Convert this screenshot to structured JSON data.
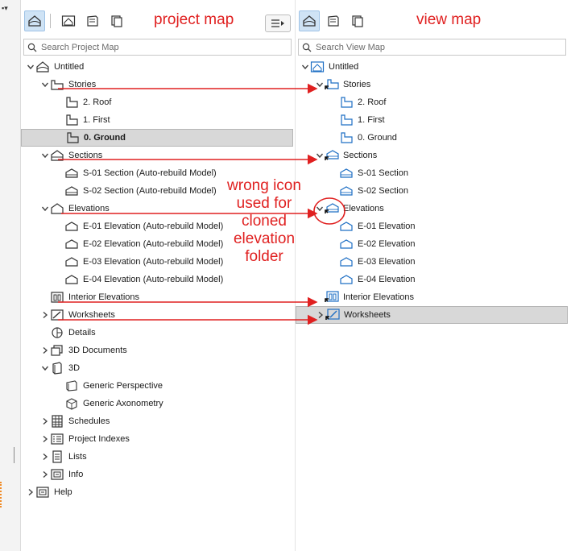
{
  "colors": {
    "accent": "#e02020",
    "selected_row": "#d8d8d8",
    "active_tab": "#cfe3f5",
    "icon_blue": "#1e6fc4"
  },
  "project_map": {
    "annotation_title": "project map",
    "search_placeholder": "Search Project Map",
    "rows": [
      {
        "label": "Untitled",
        "icon": "project-house-icon",
        "chevron": "down",
        "level": 0
      },
      {
        "label": "Stories",
        "icon": "story-folder-icon",
        "chevron": "down",
        "level": 1
      },
      {
        "label": "2. Roof",
        "icon": "story-icon",
        "chevron": "none",
        "level": 2
      },
      {
        "label": "1. First",
        "icon": "story-icon",
        "chevron": "none",
        "level": 2
      },
      {
        "label": "0. Ground",
        "icon": "story-icon",
        "chevron": "none",
        "level": 2,
        "selected": true,
        "bold": true
      },
      {
        "label": "Sections",
        "icon": "section-folder-icon",
        "chevron": "down",
        "level": 1
      },
      {
        "label": "S-01 Section (Auto-rebuild Model)",
        "icon": "section-icon",
        "chevron": "none",
        "level": 2
      },
      {
        "label": "S-02 Section (Auto-rebuild Model)",
        "icon": "section-icon",
        "chevron": "none",
        "level": 2
      },
      {
        "label": "Elevations",
        "icon": "elevation-folder-icon",
        "chevron": "down",
        "level": 1
      },
      {
        "label": "E-01 Elevation (Auto-rebuild Model)",
        "icon": "elevation-icon",
        "chevron": "none",
        "level": 2
      },
      {
        "label": "E-02 Elevation (Auto-rebuild Model)",
        "icon": "elevation-icon",
        "chevron": "none",
        "level": 2
      },
      {
        "label": "E-03 Elevation (Auto-rebuild Model)",
        "icon": "elevation-icon",
        "chevron": "none",
        "level": 2
      },
      {
        "label": "E-04 Elevation (Auto-rebuild Model)",
        "icon": "elevation-icon",
        "chevron": "none",
        "level": 2
      },
      {
        "label": "Interior Elevations",
        "icon": "interior-elevation-icon",
        "chevron": "none",
        "level": 1
      },
      {
        "label": "Worksheets",
        "icon": "worksheet-icon",
        "chevron": "right",
        "level": 1
      },
      {
        "label": "Details",
        "icon": "detail-icon",
        "chevron": "none",
        "level": 1
      },
      {
        "label": "3D Documents",
        "icon": "3d-document-icon",
        "chevron": "right",
        "level": 1
      },
      {
        "label": "3D",
        "icon": "3d-icon",
        "chevron": "down",
        "level": 1
      },
      {
        "label": "Generic Perspective",
        "icon": "perspective-icon",
        "chevron": "none",
        "level": 2
      },
      {
        "label": "Generic Axonometry",
        "icon": "axonometry-icon",
        "chevron": "none",
        "level": 2
      },
      {
        "label": "Schedules",
        "icon": "schedule-icon",
        "chevron": "right",
        "level": 1
      },
      {
        "label": "Project Indexes",
        "icon": "project-index-icon",
        "chevron": "right",
        "level": 1
      },
      {
        "label": "Lists",
        "icon": "list-icon",
        "chevron": "right",
        "level": 1
      },
      {
        "label": "Info",
        "icon": "info-icon",
        "chevron": "right",
        "level": 1
      },
      {
        "label": "Help",
        "icon": "help-icon",
        "chevron": "right",
        "level": 0
      }
    ]
  },
  "view_map": {
    "annotation_title": "view map",
    "search_placeholder": "Search View Map",
    "rows": [
      {
        "label": "Untitled",
        "icon": "view-house-icon",
        "chevron": "down",
        "level": 0
      },
      {
        "label": "Stories",
        "icon": "cloned-story-folder-icon",
        "chevron": "down",
        "level": 1
      },
      {
        "label": "2. Roof",
        "icon": "story-view-icon",
        "chevron": "none",
        "level": 2
      },
      {
        "label": "1. First",
        "icon": "story-view-icon",
        "chevron": "none",
        "level": 2
      },
      {
        "label": "0. Ground",
        "icon": "story-view-icon",
        "chevron": "none",
        "level": 2
      },
      {
        "label": "Sections",
        "icon": "cloned-section-folder-icon",
        "chevron": "down",
        "level": 1
      },
      {
        "label": "S-01 Section",
        "icon": "section-view-icon",
        "chevron": "none",
        "level": 2
      },
      {
        "label": "S-02 Section",
        "icon": "section-view-icon",
        "chevron": "none",
        "level": 2
      },
      {
        "label": "Elevations",
        "icon": "cloned-elevation-folder-icon",
        "chevron": "down",
        "level": 1
      },
      {
        "label": "E-01 Elevation",
        "icon": "elevation-view-icon",
        "chevron": "none",
        "level": 2
      },
      {
        "label": "E-02 Elevation",
        "icon": "elevation-view-icon",
        "chevron": "none",
        "level": 2
      },
      {
        "label": "E-03 Elevation",
        "icon": "elevation-view-icon",
        "chevron": "none",
        "level": 2
      },
      {
        "label": "E-04 Elevation",
        "icon": "elevation-view-icon",
        "chevron": "none",
        "level": 2
      },
      {
        "label": "Interior Elevations",
        "icon": "cloned-interior-elevation-icon",
        "chevron": "none",
        "level": 1
      },
      {
        "label": "Worksheets",
        "icon": "cloned-worksheet-icon",
        "chevron": "right",
        "level": 1,
        "selected": true
      }
    ]
  },
  "annotation_note": [
    "wrong icon",
    "used for",
    "cloned",
    "elevation",
    "folder"
  ]
}
